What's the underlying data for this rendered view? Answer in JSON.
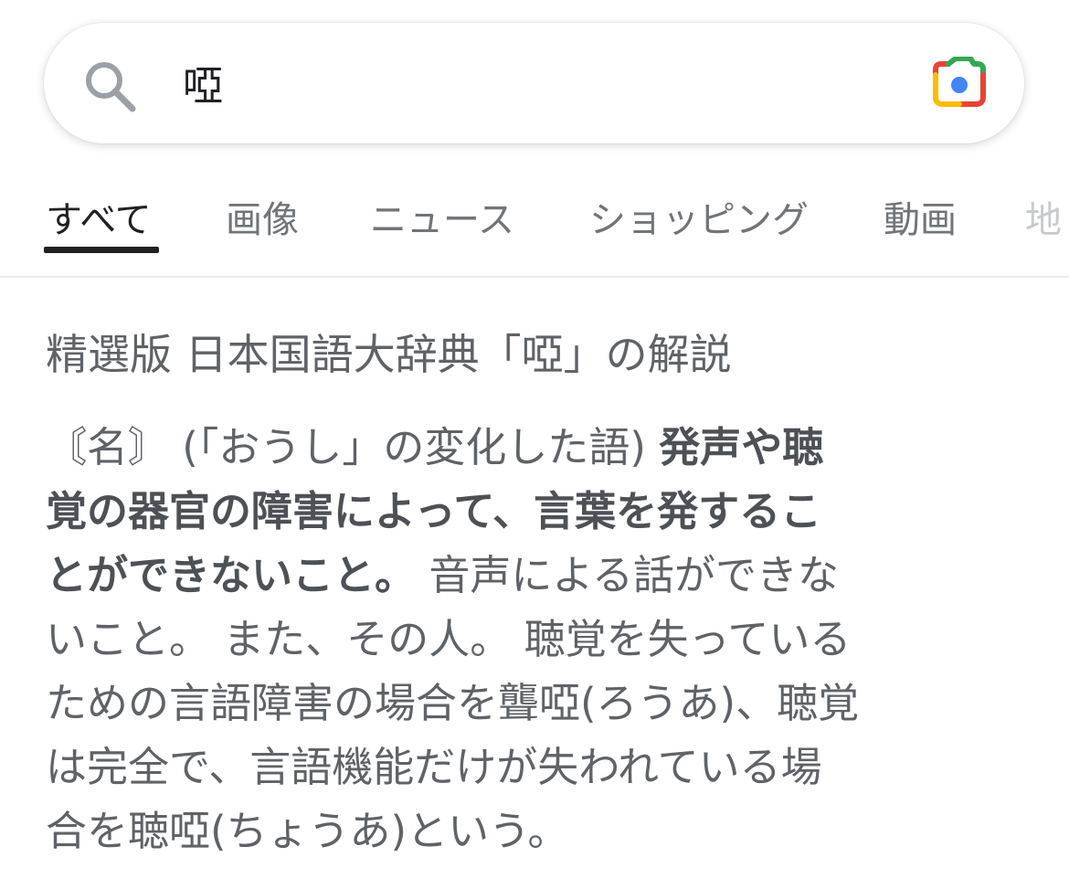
{
  "search": {
    "query": "啞"
  },
  "tabs": [
    {
      "label": "すべて",
      "active": true
    },
    {
      "label": "画像"
    },
    {
      "label": "ニュース"
    },
    {
      "label": "ショッピング"
    },
    {
      "label": "動画"
    },
    {
      "label": "地"
    }
  ],
  "result": {
    "heading": "精選版 日本国語大辞典「啞」の解説",
    "lines": [
      {
        "normal": "〘名〙 (「おうし」の変化した語) ",
        "bold": "発声や聴"
      },
      {
        "bold": "覚の器官の障害によって、言葉を発するこ"
      },
      {
        "bold": "とができないこと。",
        "normal": " 音声による話ができな"
      },
      {
        "normal": "いこと。 また、その人。 聴覚を失っている"
      },
      {
        "normal": "ための言語障害の場合を聾啞(ろうあ)、聴覚"
      },
      {
        "normal": "は完全で、言語機能だけが失われている場"
      },
      {
        "normal": "合を聴啞(ちょうあ)という。"
      }
    ]
  },
  "colors": {
    "text_primary": "#202124",
    "text_secondary": "#5f6368",
    "tab_inactive": "#70757a",
    "google_blue": "#4285f4",
    "google_red": "#ea4335",
    "google_yellow": "#fbbc04",
    "google_green": "#34a853"
  },
  "icons": {
    "search": "search-icon",
    "camera": "google-lens-icon"
  }
}
